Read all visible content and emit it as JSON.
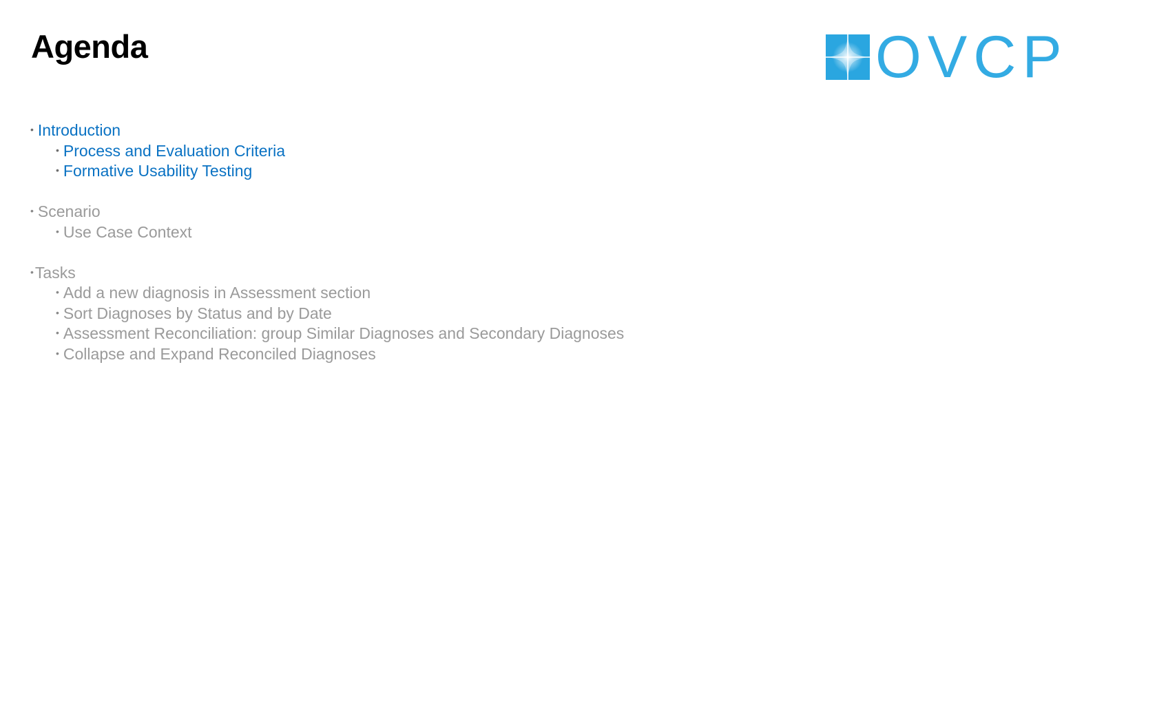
{
  "slide": {
    "title": "Agenda"
  },
  "logo": {
    "icon": "ovcp-logo-mark",
    "text": "OVCP",
    "color": "#33abe3"
  },
  "colors": {
    "active": "#0a72c3",
    "inactive": "#9a9a9a"
  },
  "agenda": {
    "bullet": "•",
    "sections": [
      {
        "label": "Introduction",
        "state": "active",
        "items": [
          "Process and Evaluation Criteria",
          "Formative Usability Testing"
        ]
      },
      {
        "label": "Scenario",
        "state": "inactive",
        "items": [
          "Use Case Context"
        ]
      },
      {
        "label": "Tasks",
        "state": "inactive",
        "items": [
          "Add a new diagnosis in Assessment section",
          "Sort Diagnoses by Status and by Date",
          "Assessment Reconciliation: group Similar Diagnoses and Secondary Diagnoses",
          "Collapse and Expand Reconciled Diagnoses"
        ]
      }
    ]
  }
}
